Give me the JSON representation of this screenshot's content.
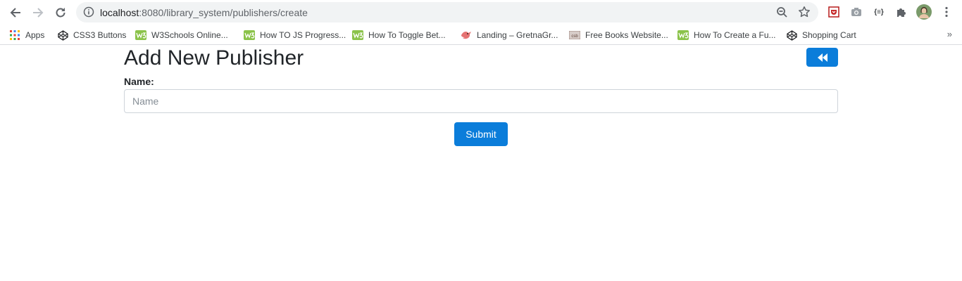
{
  "browser": {
    "url_host": "localhost",
    "url_path": ":8080/library_system/publishers/create",
    "icons": [
      "back-arrow-icon",
      "forward-arrow-icon",
      "reload-icon",
      "info-icon",
      "zoom-icon",
      "star-icon",
      "shield-extension-icon",
      "camera-extension-icon",
      "json-extension-icon",
      "puzzle-icon",
      "profile-avatar",
      "kebab-menu-icon"
    ],
    "json_ext_label": "{≡}"
  },
  "bookmarks": {
    "items": [
      {
        "label": "Apps",
        "icon": "apps-grid-icon"
      },
      {
        "label": "CSS3 Buttons",
        "icon": "codepen-icon"
      },
      {
        "label": "W3Schools Online...",
        "icon": "w3schools-icon"
      },
      {
        "label": "How TO JS Progress...",
        "icon": "w3schools-icon"
      },
      {
        "label": "How To Toggle Bet...",
        "icon": "w3schools-icon"
      },
      {
        "label": "Landing – GretnaGr...",
        "icon": "bird-icon"
      },
      {
        "label": "Free Books Website...",
        "icon": "csb-icon"
      },
      {
        "label": "How To Create a Fu...",
        "icon": "w3schools-icon"
      },
      {
        "label": "Shopping Cart",
        "icon": "codepen-icon"
      }
    ],
    "more": "»"
  },
  "page": {
    "title": "Add New Publisher",
    "back_button_icon": "double-chevron-left-icon",
    "name_label": "Name:",
    "name_placeholder": "Name",
    "name_value": "",
    "submit_label": "Submit"
  },
  "colors": {
    "primary": "#0b7dda",
    "text": "#212529",
    "omnibox": "#f1f3f4"
  }
}
